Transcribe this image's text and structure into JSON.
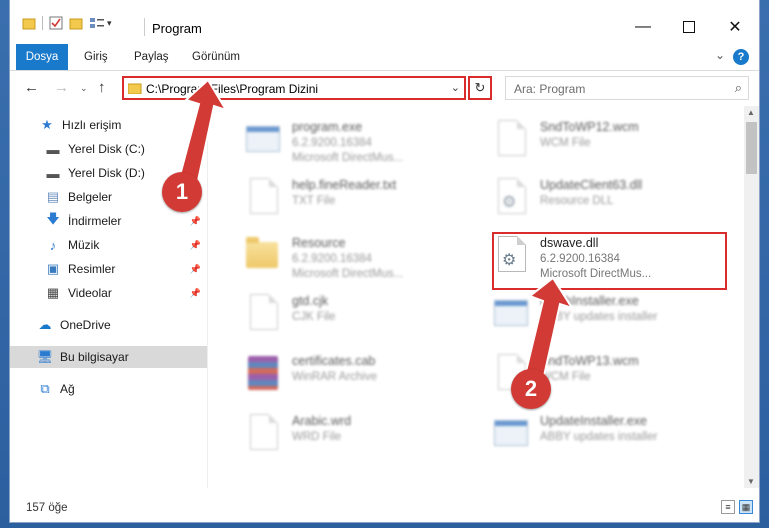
{
  "window": {
    "title": "Program"
  },
  "ribbon": {
    "tabs": [
      "Dosya",
      "Giriş",
      "Paylaş",
      "Görünüm"
    ],
    "help": "?"
  },
  "address": {
    "path": "C:\\Program Files\\Program Dizini"
  },
  "search": {
    "placeholder": "Ara: Program"
  },
  "sidebar": {
    "items": [
      {
        "label": "Hızlı erişim",
        "icon": "star-icon"
      },
      {
        "label": "Yerel Disk (C:)",
        "icon": "drive-icon"
      },
      {
        "label": "Yerel Disk (D:)",
        "icon": "drive-icon"
      },
      {
        "label": "Belgeler",
        "icon": "documents-icon"
      },
      {
        "label": "İndirmeler",
        "icon": "download-icon"
      },
      {
        "label": "Müzik",
        "icon": "music-icon"
      },
      {
        "label": "Resimler",
        "icon": "pictures-icon"
      },
      {
        "label": "Videolar",
        "icon": "video-icon"
      },
      {
        "label": "OneDrive",
        "icon": "cloud-icon"
      },
      {
        "label": "Bu bilgisayar",
        "icon": "computer-icon"
      },
      {
        "label": "Ağ",
        "icon": "network-icon"
      }
    ]
  },
  "files": {
    "left": [
      {
        "name": "program.exe",
        "line1": "6.2.9200.16384",
        "line2": "Microsoft DirectMus..."
      },
      {
        "name": "help.fineReader.txt",
        "line1": "TXT File",
        "line2": ""
      },
      {
        "name": "Resource",
        "line1": "6.2.9200.16384",
        "line2": "Microsoft DirectMus..."
      },
      {
        "name": "gtd.cjk",
        "line1": "CJK File",
        "line2": ""
      },
      {
        "name": "certificates.cab",
        "line1": "WinRAR Archive",
        "line2": ""
      },
      {
        "name": "Arabic.wrd",
        "line1": "WRD File",
        "line2": ""
      }
    ],
    "right": [
      {
        "name": "SndToWP12.wcm",
        "line1": "WCM File",
        "line2": ""
      },
      {
        "name": "UpdateClient63.dll",
        "line1": "Resource DLL",
        "line2": ""
      },
      {
        "name": "dswave.dll",
        "line1": "6.2.9200.16384",
        "line2": "Microsoft DirectMus..."
      },
      {
        "name": "BatchInstaller.exe",
        "line1": "ABBY updates installer",
        "line2": ""
      },
      {
        "name": "SndToWP13.wcm",
        "line1": "WCM File",
        "line2": ""
      },
      {
        "name": "UpdateInstaller.exe",
        "line1": "ABBY updates installer",
        "line2": ""
      }
    ]
  },
  "status": {
    "count": "157 öğe"
  },
  "annotations": {
    "step1": "1",
    "step2": "2"
  },
  "colors": {
    "accent": "#1979ca",
    "annotation": "#d23a35"
  }
}
